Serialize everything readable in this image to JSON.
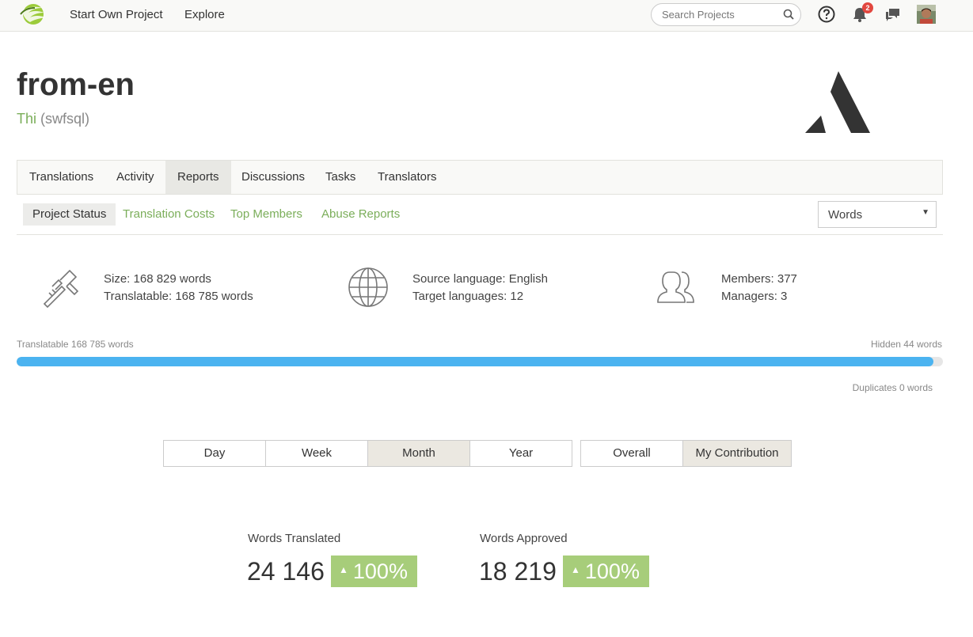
{
  "nav": {
    "links": [
      "Start Own Project",
      "Explore"
    ],
    "search_placeholder": "Search Projects",
    "notifications_count": "2"
  },
  "project": {
    "title": "from-en",
    "owner_name": "Thi",
    "owner_handle": "(swfsql)"
  },
  "main_tabs": [
    "Translations",
    "Activity",
    "Reports",
    "Discussions",
    "Tasks",
    "Translators"
  ],
  "active_main_tab": "Reports",
  "sub_tabs": [
    "Project Status",
    "Translation Costs",
    "Top Members",
    "Abuse Reports"
  ],
  "active_sub_tab": "Project Status",
  "unit_select": {
    "value": "Words"
  },
  "stats": {
    "size": "Size: 168 829 words",
    "translatable": "Translatable: 168 785 words",
    "source_language": "Source language: English",
    "target_languages": "Target languages: 12",
    "members": "Members: 377",
    "managers": "Managers: 3"
  },
  "progress": {
    "left_label": "Translatable 168 785 words",
    "right_label": "Hidden 44 words",
    "duplicates_label": "Duplicates 0 words",
    "fraction": 0.99
  },
  "period_buttons": [
    "Day",
    "Week",
    "Month",
    "Year"
  ],
  "active_period": "Month",
  "scope_buttons": [
    "Overall",
    "My Contribution"
  ],
  "active_scope": "My Contribution",
  "metrics": [
    {
      "label": "Words Translated",
      "value": "24 146",
      "change": "100%"
    },
    {
      "label": "Words Approved",
      "value": "18 219",
      "change": "100%"
    }
  ],
  "colors": {
    "accent_green": "#7bae5a",
    "progress_blue": "#4bb3f0",
    "badge_green": "#a7cd7a",
    "notification_red": "#e2473f"
  }
}
